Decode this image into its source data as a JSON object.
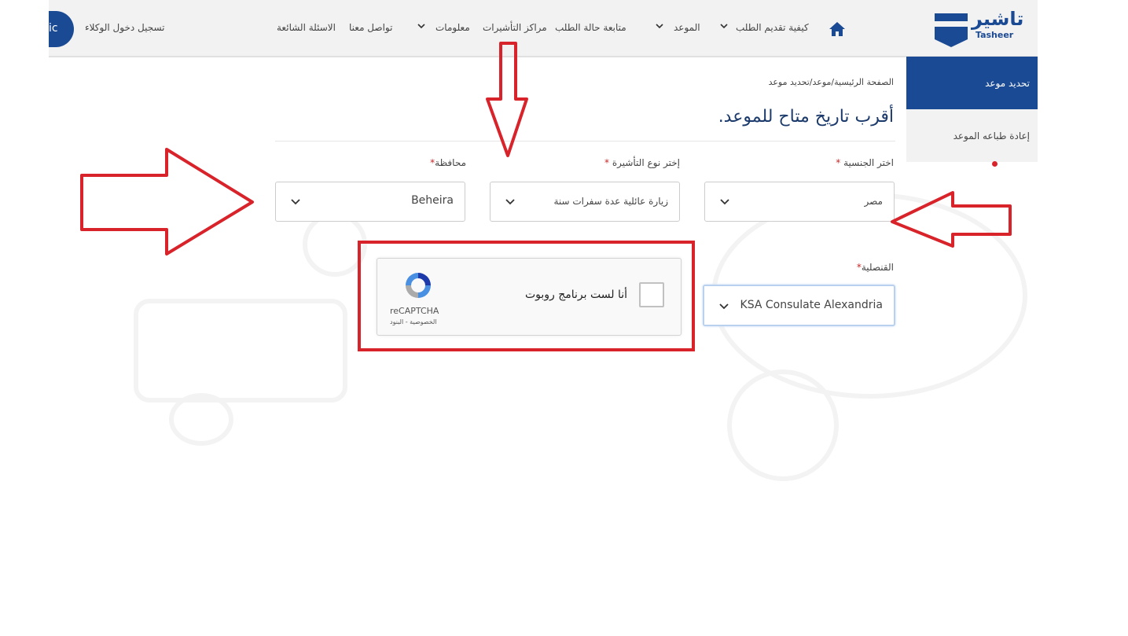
{
  "header": {
    "logo_ar": "تاشير",
    "logo_en": "Tasheer",
    "lang_button": "ic",
    "agent_login": "تسجيل دخول الوكلاء",
    "nav": {
      "how_to_apply": "كيفية تقديم الطلب",
      "appointment": "الموعد",
      "track_status": "متابعة حالة الطلب",
      "visa_centers": "مراكز التأشيرات",
      "information": "معلومات",
      "contact": "تواصل معنا",
      "faq": "الاسئلة الشائعة"
    }
  },
  "sidebar": {
    "items": [
      {
        "label": "تحديد موعد",
        "active": true
      },
      {
        "label": "إعادة طباعه الموعد",
        "active": false
      }
    ]
  },
  "main": {
    "breadcrumb": "الصفحة الرئيسية/موعد/تحديد موعد",
    "title": "أقرب تاريخ متاح للموعد.",
    "fields": {
      "nationality": {
        "label": "اختر الجنسية",
        "required_mark": "*",
        "value": "مصر"
      },
      "visa_type": {
        "label": "إختر نوع التأشيرة",
        "required_mark": "*",
        "value": "زيارة عائلية عدة سفرات سنة"
      },
      "governorate": {
        "label": "محافظة",
        "required_mark": "*",
        "value": "Beheira"
      },
      "consulate": {
        "label": "القنصلية",
        "required_mark": "*",
        "value": "KSA Consulate Alexandria"
      }
    },
    "captcha": {
      "label": "أنا لست برنامج روبوت",
      "brand": "reCAPTCHA",
      "links": "الخصوصية - البنود",
      "checked": false
    }
  },
  "colors": {
    "brand_blue": "#1b4a94",
    "annotation_red": "#d9232a",
    "required_red": "#c62828"
  },
  "icons": [
    "home-icon",
    "chevron-down-icon",
    "recaptcha-logo-icon",
    "tasheer-logo-icon"
  ]
}
